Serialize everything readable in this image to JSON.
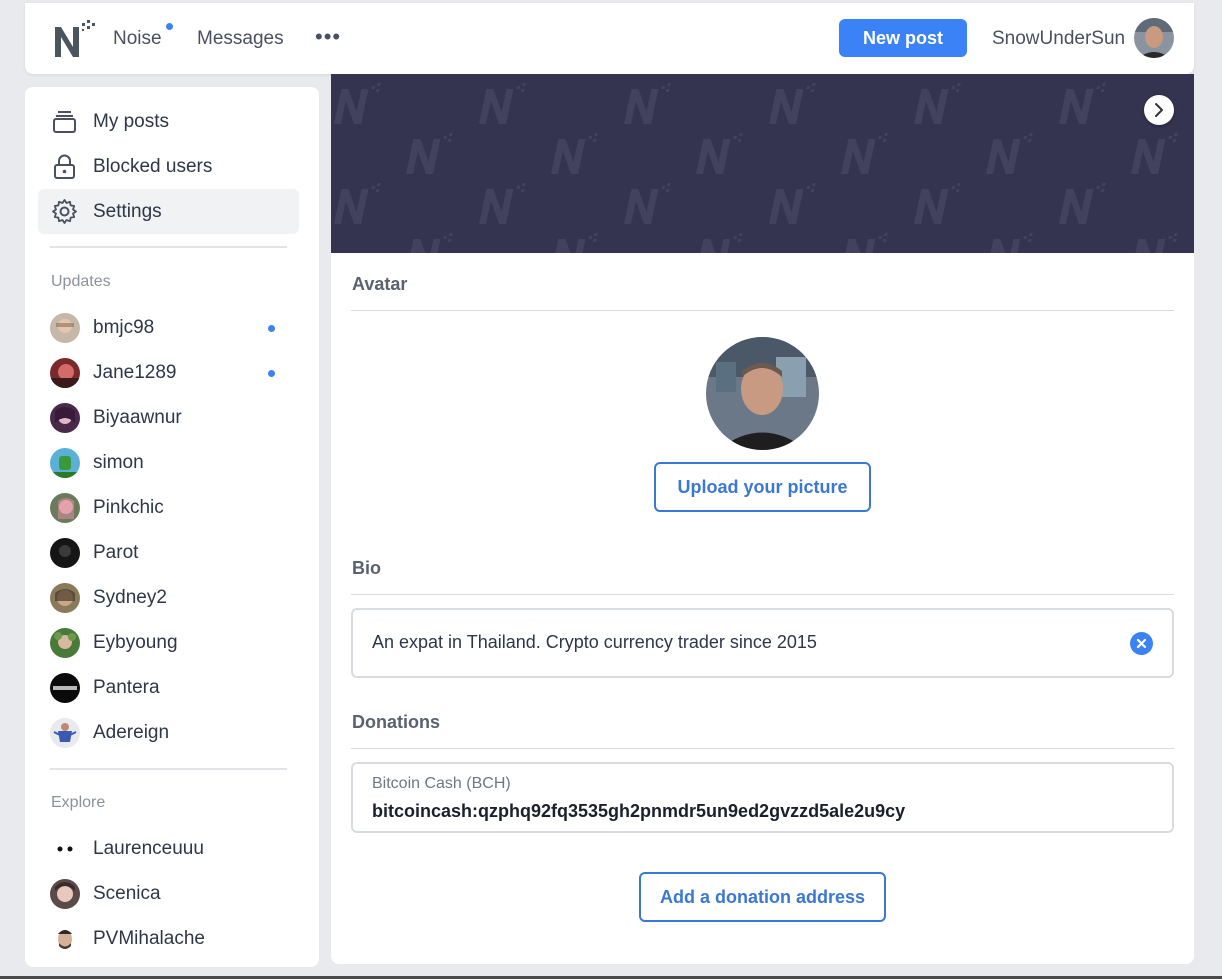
{
  "header": {
    "nav_noise": "Noise",
    "nav_messages": "Messages",
    "more": "•••",
    "new_post": "New post",
    "username": "SnowUnderSun",
    "logo_letter": "N"
  },
  "sidebar": {
    "menu": [
      {
        "label": "My posts",
        "icon": "stack-icon"
      },
      {
        "label": "Blocked users",
        "icon": "lock-icon"
      },
      {
        "label": "Settings",
        "icon": "gear-icon",
        "active": true
      }
    ],
    "updates_title": "Updates",
    "updates": [
      {
        "name": "bmjc98",
        "unread": true
      },
      {
        "name": "Jane1289",
        "unread": true
      },
      {
        "name": "Biyaawnur",
        "unread": false
      },
      {
        "name": "simon",
        "unread": false
      },
      {
        "name": "Pinkchic",
        "unread": false
      },
      {
        "name": "Parot",
        "unread": false
      },
      {
        "name": "Sydney2",
        "unread": false
      },
      {
        "name": "Eybyoung",
        "unread": false
      },
      {
        "name": "Pantera",
        "unread": false
      },
      {
        "name": "Adereign",
        "unread": false
      }
    ],
    "explore_title": "Explore",
    "explore": [
      {
        "name": "Laurenceuuu"
      },
      {
        "name": "Scenica"
      },
      {
        "name": "PVMihalache"
      }
    ]
  },
  "main": {
    "avatar_section": "Avatar",
    "upload_button": "Upload your picture",
    "bio_section": "Bio",
    "bio_text": "An expat in Thailand. Crypto currency trader since 2015",
    "donations_section": "Donations",
    "donation_label": "Bitcoin Cash (BCH)",
    "donation_address": "bitcoincash:qzphq92fq3535gh2pnmdr5un9ed2gvzzd5ale2u9cy",
    "add_donation_button": "Add a donation address"
  },
  "colors": {
    "accent": "#3b82f6",
    "banner": "#343350",
    "outline_button": "#3b78d6"
  }
}
